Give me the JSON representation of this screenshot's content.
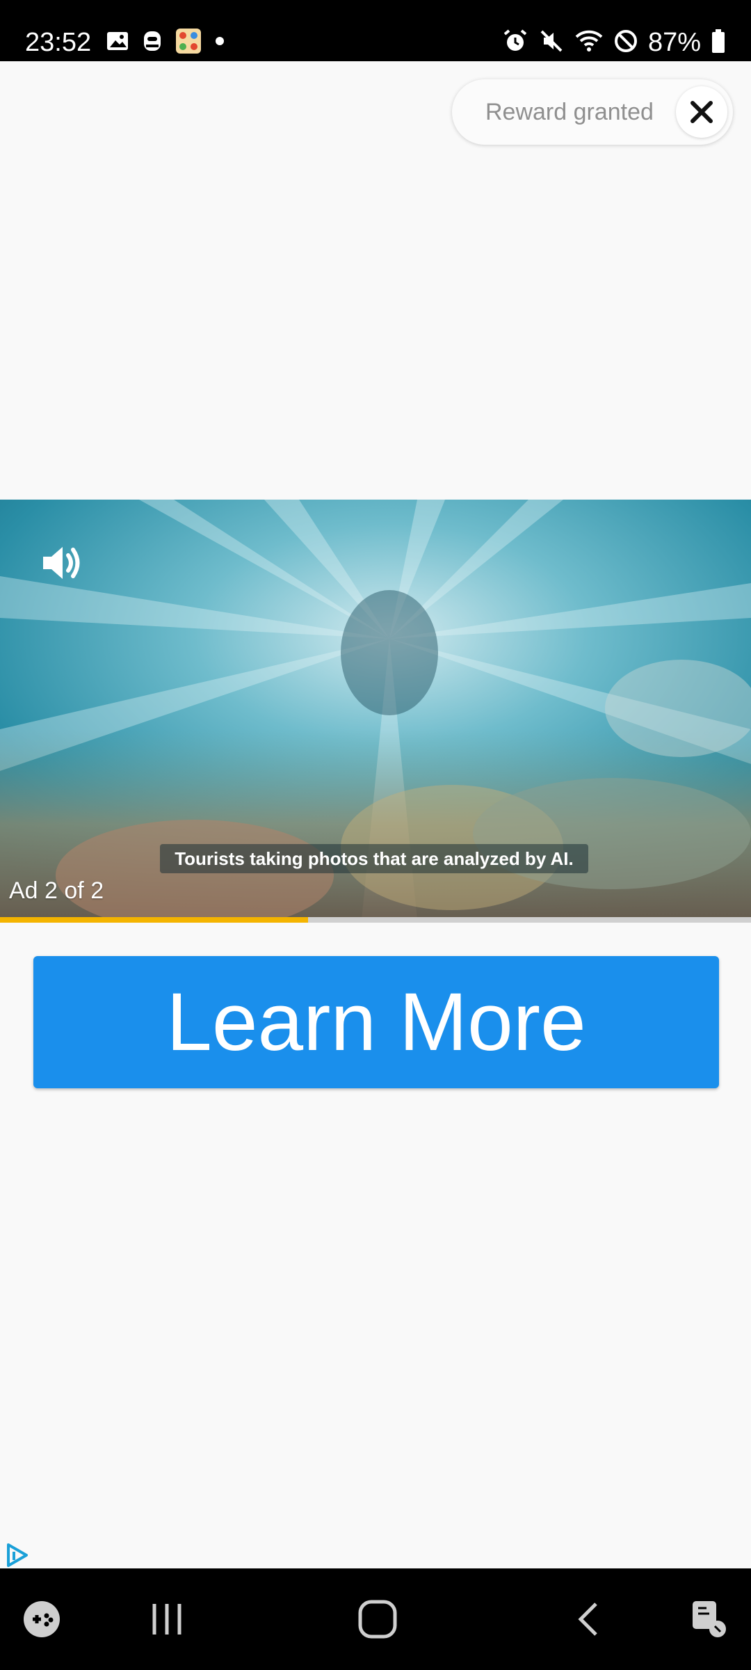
{
  "status_bar": {
    "time": "23:52",
    "battery_percent": "87%",
    "notification_icons": [
      "image-icon",
      "app-icon",
      "game-app-icon",
      "dot-icon"
    ],
    "system_icons": [
      "alarm-icon",
      "mute-icon",
      "wifi-icon",
      "do-not-disturb-icon",
      "battery-icon"
    ]
  },
  "reward": {
    "label": "Reward granted",
    "close_icon": "close-icon"
  },
  "video": {
    "caption": "Tourists taking photos that are analyzed by AI.",
    "ad_counter": "Ad 2 of 2",
    "sound_icon": "speaker-icon",
    "progress": 0.41
  },
  "cta": {
    "label": "Learn More",
    "color": "#1a8fec"
  },
  "ad_choices_icon": "adchoices-icon",
  "nav_bar": {
    "items": [
      "game-tools-icon",
      "recents-icon",
      "home-icon",
      "back-icon",
      "accessibility-icon"
    ]
  }
}
